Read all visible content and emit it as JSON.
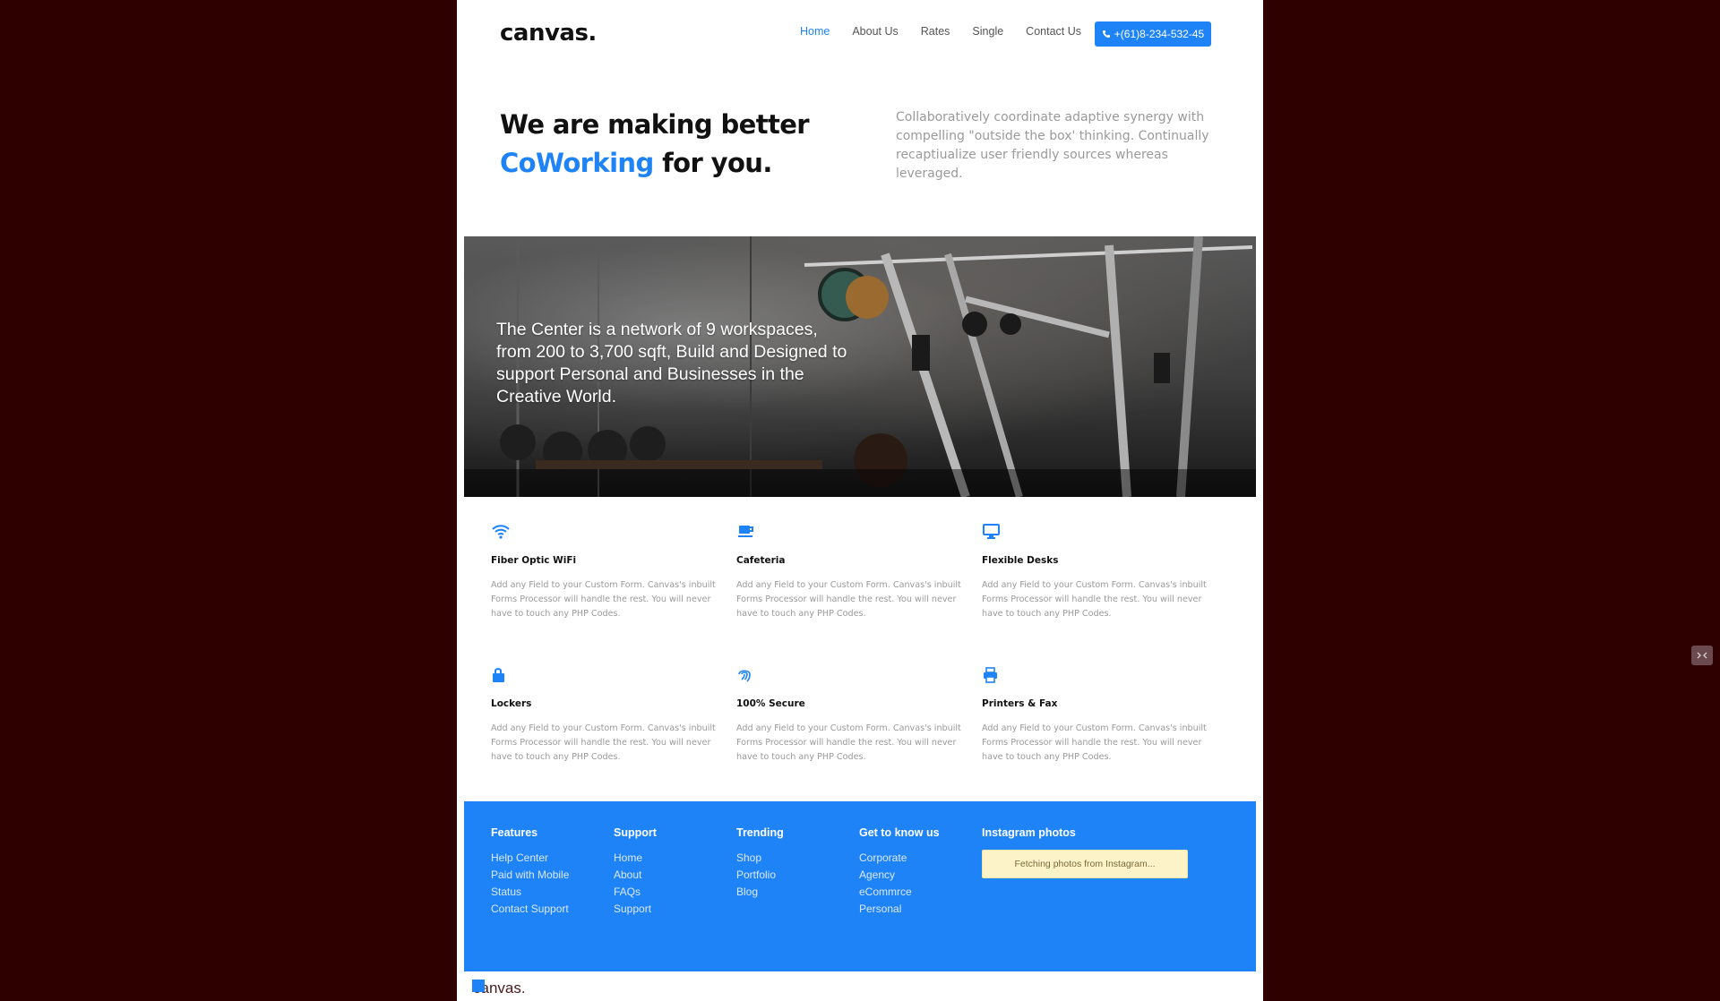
{
  "header": {
    "logo": "canvas.",
    "nav": [
      {
        "label": "Home",
        "active": true
      },
      {
        "label": "About Us",
        "active": false
      },
      {
        "label": "Rates",
        "active": false
      },
      {
        "label": "Single",
        "active": false
      },
      {
        "label": "Contact Us",
        "active": false
      }
    ],
    "phone": "+(61)8-234-532-45",
    "phone_icon": "phone-icon"
  },
  "hero": {
    "title_line1": "We are making better",
    "title_accent": "CoWorking",
    "title_end": " for you.",
    "description": "Collaboratively coordinate adaptive synergy with compelling \"outside the box' thinking. Continually recaptiualize user friendly sources whereas leveraged."
  },
  "banner": {
    "text": "The Center is a network of 9 workspaces, from 200 to 3,700 sqft, Build and Designed to support Personal and Businesses in the Creative World."
  },
  "features": [
    {
      "icon": "wifi-icon",
      "title": "Fiber Optic WiFi",
      "description": "Add any Field to your Custom Form. Canvas's inbuilt Forms Processor will handle the rest. You will never have to touch any PHP Codes."
    },
    {
      "icon": "coffee-cup-icon",
      "title": "Cafeteria",
      "description": "Add any Field to your Custom Form. Canvas's inbuilt Forms Processor will handle the rest. You will never have to touch any PHP Codes."
    },
    {
      "icon": "desktop-icon",
      "title": "Flexible Desks",
      "description": "Add any Field to your Custom Form. Canvas's inbuilt Forms Processor will handle the rest. You will never have to touch any PHP Codes."
    },
    {
      "icon": "lock-icon",
      "title": "Lockers",
      "description": "Add any Field to your Custom Form. Canvas's inbuilt Forms Processor will handle the rest. You will never have to touch any PHP Codes."
    },
    {
      "icon": "fingerprint-icon",
      "title": "100% Secure",
      "description": "Add any Field to your Custom Form. Canvas's inbuilt Forms Processor will handle the rest. You will never have to touch any PHP Codes."
    },
    {
      "icon": "printer-icon",
      "title": "Printers & Fax",
      "description": "Add any Field to your Custom Form. Canvas's inbuilt Forms Processor will handle the rest. You will never have to touch any PHP Codes."
    }
  ],
  "footer": {
    "columns": [
      {
        "title": "Features",
        "links": [
          "Help Center",
          "Paid with Mobile",
          "Status",
          "Contact Support"
        ]
      },
      {
        "title": "Support",
        "links": [
          "Home",
          "About",
          "FAQs",
          "Support"
        ]
      },
      {
        "title": "Trending",
        "links": [
          "Shop",
          "Portfolio",
          "Blog"
        ]
      },
      {
        "title": "Get to know us",
        "links": [
          "Corporate",
          "Agency",
          "eCommrce",
          "Personal"
        ]
      }
    ],
    "instagram_title": "Instagram photos",
    "instagram_status": "Fetching photos from Instagram..."
  },
  "bottom_logo": "canvas.",
  "colors": {
    "accent": "#1e83f7",
    "outer_background": "#2e0000"
  }
}
